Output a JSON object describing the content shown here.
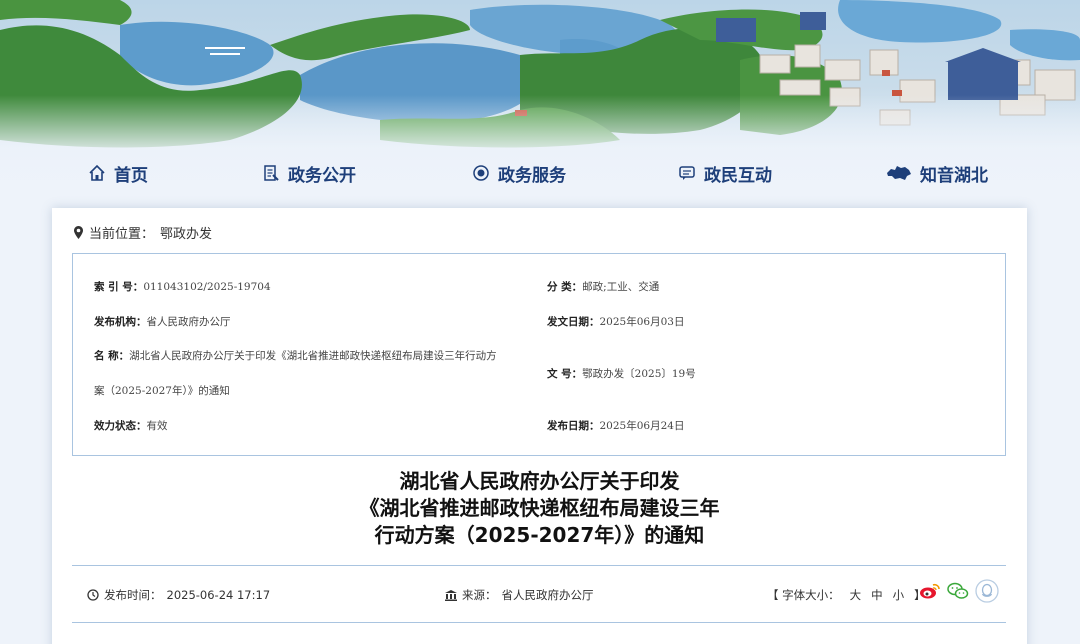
{
  "nav": {
    "items": [
      {
        "label": "首页",
        "icon": "home-icon"
      },
      {
        "label": "政务公开",
        "icon": "document-icon"
      },
      {
        "label": "政务服务",
        "icon": "service-icon"
      },
      {
        "label": "政民互动",
        "icon": "chat-icon"
      },
      {
        "label": "知音湖北",
        "icon": "hubei-map-icon"
      }
    ]
  },
  "breadcrumb": {
    "prefix": "当前位置：",
    "current": "鄂政办发"
  },
  "meta": {
    "index_key": "索 引 号：",
    "index_val": "011043102/2025-19704",
    "category_key": "分    类：",
    "category_val": "邮政;工业、交通",
    "publisher_key": "发布机构：",
    "publisher_val": "省人民政府办公厅",
    "doc_date_key": "发文日期：",
    "doc_date_val": "2025年06月03日",
    "name_key": "名    称：",
    "name_val_line1": "湖北省人民政府办公厅关于印发《湖北省推进邮政快递枢纽布局建设三年行动方",
    "name_val_line2": "案（2025-2027年）》的通知",
    "doc_no_key": "文    号：",
    "doc_no_val": "鄂政办发〔2025〕19号",
    "status_key": "效力状态：",
    "status_val": "有效",
    "pub_date_key": "发布日期：",
    "pub_date_val": "2025年06月24日"
  },
  "title": {
    "line1": "湖北省人民政府办公厅关于印发",
    "line2": "《湖北省推进邮政快递枢纽布局建设三年",
    "line3": "行动方案（2025-2027年）》的通知"
  },
  "info": {
    "time_label": "发布时间：",
    "time_value": "2025-06-24 17:17",
    "source_label": "来源：",
    "source_value": "省人民政府办公厅",
    "font_size_label": "【 字体大小：",
    "font_large": "大",
    "font_medium": "中",
    "font_small": "小",
    "font_size_close": "】"
  },
  "colors": {
    "nav_text": "#1e3f7a",
    "border": "#a9c4e0",
    "weibo": "#e6162d",
    "wechat": "#3aa83a"
  }
}
